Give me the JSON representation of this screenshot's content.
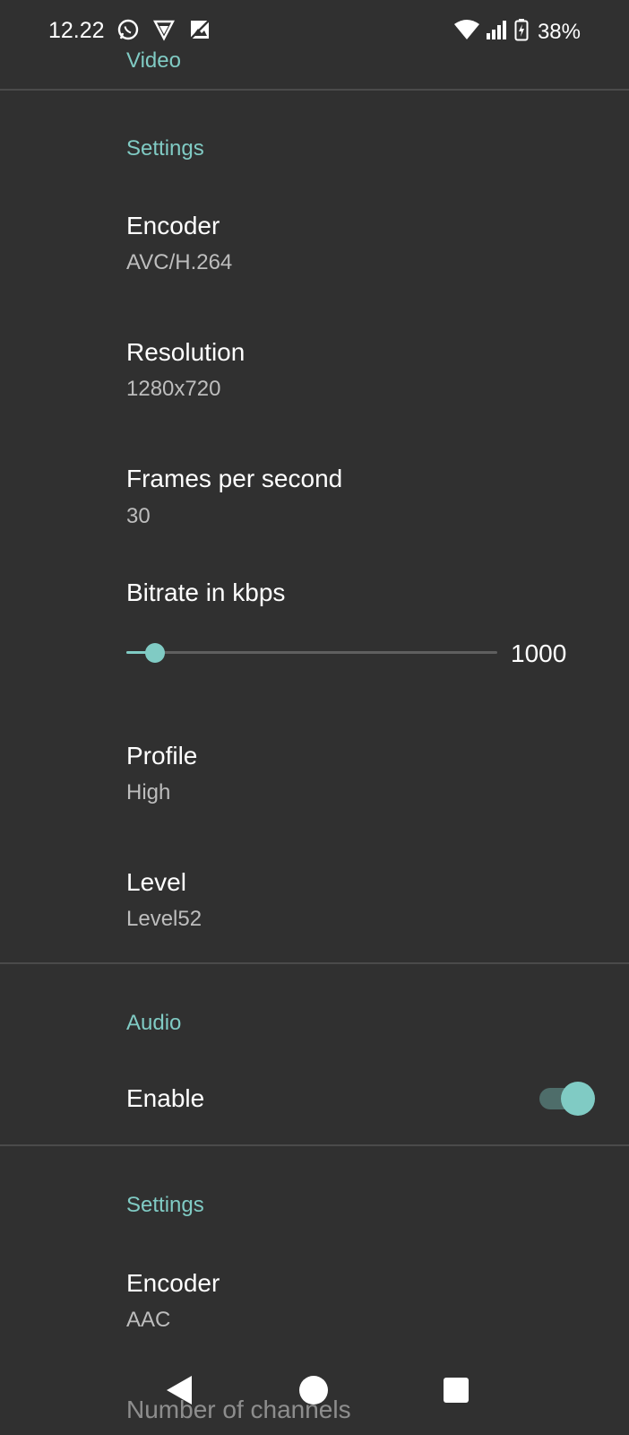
{
  "status_bar": {
    "time": "12.22",
    "battery": "38%"
  },
  "video": {
    "section_label": "Video",
    "settings_label": "Settings",
    "encoder": {
      "title": "Encoder",
      "value": "AVC/H.264"
    },
    "resolution": {
      "title": "Resolution",
      "value": "1280x720"
    },
    "fps": {
      "title": "Frames per second",
      "value": "30"
    },
    "bitrate": {
      "title": "Bitrate in kbps",
      "value": "1000",
      "slider_fraction": 0.03
    },
    "profile": {
      "title": "Profile",
      "value": "High"
    },
    "level": {
      "title": "Level",
      "value": "Level52"
    }
  },
  "audio": {
    "section_label": "Audio",
    "enable": {
      "title": "Enable",
      "checked": true
    },
    "settings_label": "Settings",
    "encoder": {
      "title": "Encoder",
      "value": "AAC"
    },
    "channels": {
      "title": "Number of channels"
    }
  },
  "colors": {
    "background": "#303030",
    "accent": "#80cbc4",
    "summary_text": "#bdbdbd",
    "divider": "#4a4a4a"
  },
  "icons": [
    "whatsapp-icon",
    "vpn-shield-icon",
    "image-blocked-icon",
    "wifi-icon",
    "signal-icon",
    "battery-charging-icon",
    "back-icon",
    "home-icon",
    "recents-icon"
  ]
}
